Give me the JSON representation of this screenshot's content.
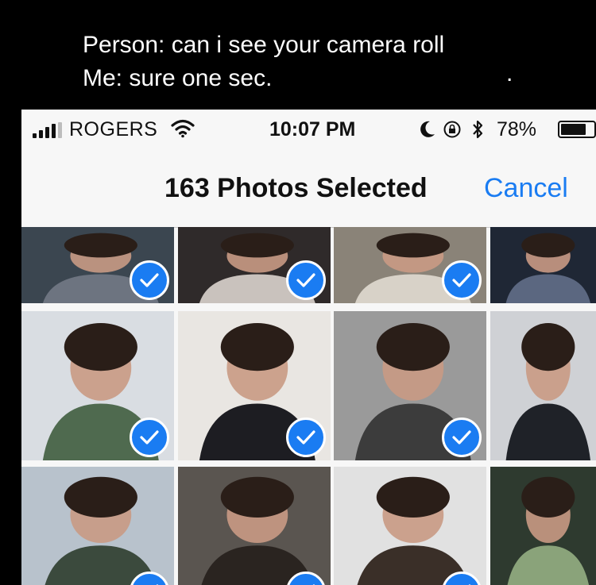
{
  "caption": {
    "line1": "Person: can i see your camera roll",
    "line2": "Me: sure one sec.",
    "dot": "."
  },
  "status_bar": {
    "carrier": "ROGERS",
    "time": "10:07 PM",
    "battery": "78%",
    "battery_level": 0.78,
    "icons": [
      "signal-icon",
      "wifi-icon",
      "moon-icon",
      "rotation-lock-icon",
      "bluetooth-icon",
      "battery-icon"
    ]
  },
  "nav": {
    "title": "163 Photos Selected",
    "cancel_label": "Cancel"
  },
  "colors": {
    "accent": "#1a7cf2",
    "background": "#000000",
    "bar": "#f7f7f7"
  },
  "grid": {
    "photos": [
      {
        "selected": true
      },
      {
        "selected": true
      },
      {
        "selected": true
      },
      {
        "selected": true
      },
      {
        "selected": true
      },
      {
        "selected": true
      },
      {
        "selected": true
      },
      {
        "selected": true
      },
      {
        "selected": true
      },
      {
        "selected": true
      },
      {
        "selected": true
      },
      {
        "selected": true
      }
    ]
  }
}
